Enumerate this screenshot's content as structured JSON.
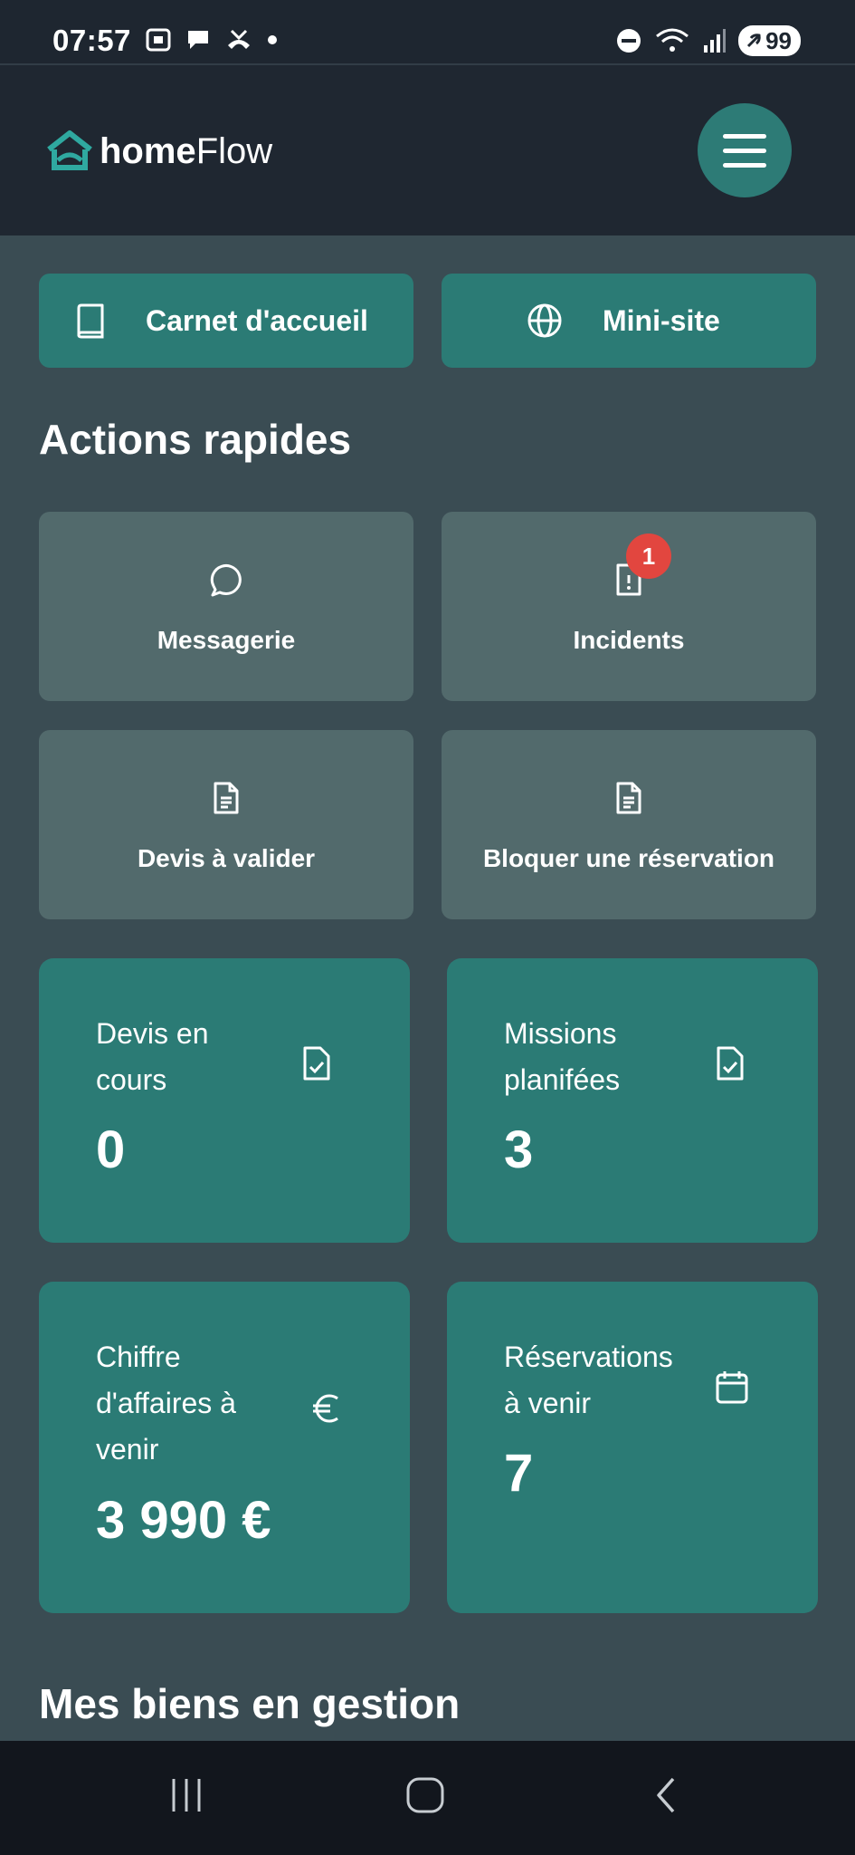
{
  "status_bar": {
    "time": "07:57",
    "battery": "99",
    "left_icons": [
      "screenshot-icon",
      "chat-bubble-icon",
      "missed-call-icon",
      "dot-icon"
    ],
    "right_icons": [
      "do-not-disturb-icon",
      "wifi-icon",
      "signal-icon",
      "battery-icon"
    ]
  },
  "header": {
    "logo_part1": "home",
    "logo_part2": "Flow",
    "menu_icon": "hamburger-menu-icon"
  },
  "links": [
    {
      "label": "Carnet d'accueil",
      "icon": "book-icon"
    },
    {
      "label": "Mini-site",
      "icon": "globe-icon"
    }
  ],
  "quick_actions": {
    "title": "Actions rapides",
    "items": [
      {
        "label": "Messagerie",
        "icon": "message-circle-icon"
      },
      {
        "label": "Incidents",
        "icon": "alert-file-icon",
        "badge": "1"
      },
      {
        "label": "Devis à valider",
        "icon": "document-icon"
      },
      {
        "label": "Bloquer une réservation",
        "icon": "document-icon"
      }
    ]
  },
  "stats": [
    {
      "title": "Devis en cours",
      "value": "0",
      "icon": "file-check-icon"
    },
    {
      "title": "Missions planifées",
      "value": "3",
      "icon": "file-check-icon"
    },
    {
      "title": "Chiffre d'affaires à venir",
      "value": "3 990 €",
      "icon": "euro-icon"
    },
    {
      "title": "Réservations à venir",
      "value": "7",
      "icon": "calendar-icon"
    }
  ],
  "properties": {
    "title": "Mes biens en gestion"
  },
  "nav": {
    "icons": [
      "recent-apps-icon",
      "home-icon",
      "back-icon"
    ]
  },
  "colors": {
    "background": "#3a4c53",
    "header": "#1f2731",
    "accent": "#2b7b75",
    "card": "#526a6c",
    "badge": "#e2463f"
  }
}
